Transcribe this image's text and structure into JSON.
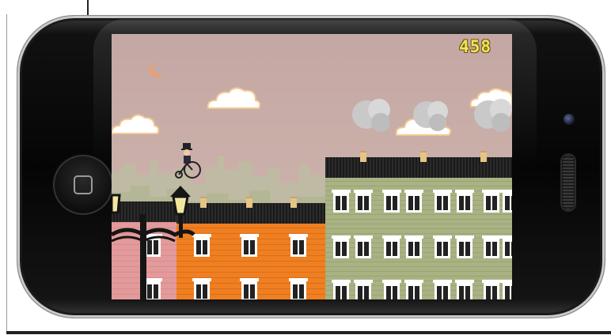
{
  "game": {
    "score": "458",
    "scene": "rooftops-night",
    "colors": {
      "sky": "#c4a7a4",
      "score_text": "#f3e25a",
      "building_orange": "#f07f22",
      "building_green": "#a8b283",
      "building_pink": "#e39a9b",
      "roof": "#222222"
    }
  },
  "device": {
    "home_button_icon": "home-square-icon",
    "camera_icon": "front-camera-icon",
    "speaker_icon": "speaker-grille-icon"
  },
  "sprites": {
    "player": "penny-farthing-rider-icon",
    "moon": "crescent-moon-icon",
    "lamp": "street-lamp-icon"
  }
}
